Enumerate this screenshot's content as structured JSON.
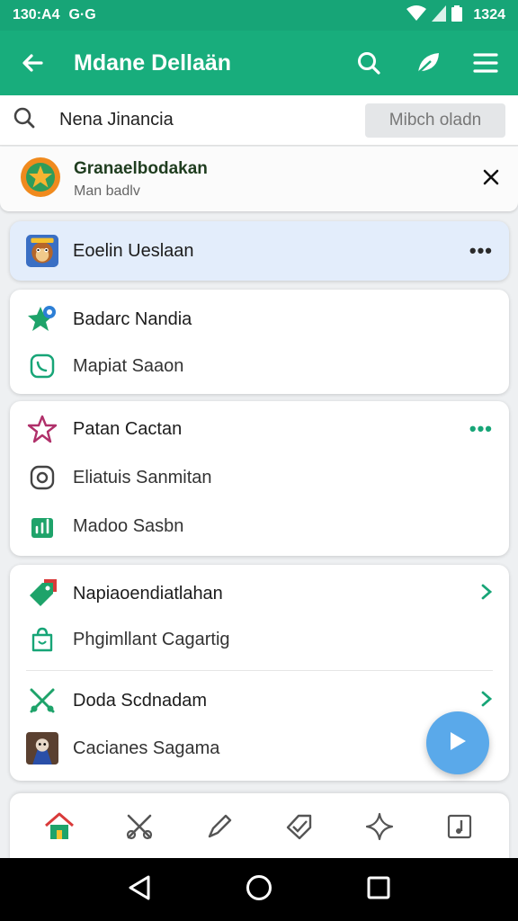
{
  "status_bar": {
    "time": "130:A4",
    "left_extra": "G·G",
    "battery_text": "1324"
  },
  "app_bar": {
    "title": "Mdane Dellaän",
    "icons": [
      "back-arrow-icon",
      "search-icon",
      "leaf-icon",
      "menu-icon"
    ]
  },
  "search": {
    "value": "Nena Jinancia",
    "button_label": "Mibch oladn"
  },
  "notice": {
    "title": "Granaelbodakan",
    "subtitle": "Man badlv"
  },
  "sections": {
    "highlight": {
      "label": "Eoelin Ueslaan",
      "more": "•••"
    },
    "card1": [
      {
        "label": "Badarc Nandia"
      },
      {
        "label": "Mapiat Saaon"
      }
    ],
    "card2": [
      {
        "label": "Patan Cactan",
        "more": "•••"
      },
      {
        "label": "Eliatuis Sanmitan"
      },
      {
        "label": "Madoo Sasbn"
      }
    ],
    "card3": [
      {
        "label": "Napiaoendiatlahan"
      },
      {
        "label": "Phgimllant Cagartig"
      },
      {
        "label": "Doda Scdnadam"
      },
      {
        "label": "Cacianes Sagama"
      }
    ]
  },
  "bottom_bar_icons": [
    "home-icon",
    "tools-icon",
    "pen-icon",
    "tag-check-icon",
    "sparkle-icon",
    "music-note-icon"
  ],
  "colors": {
    "primary": "#18ad7c",
    "status_bar": "#17a577",
    "fab": "#5aa9ea",
    "highlight_card": "#e3edfb"
  }
}
